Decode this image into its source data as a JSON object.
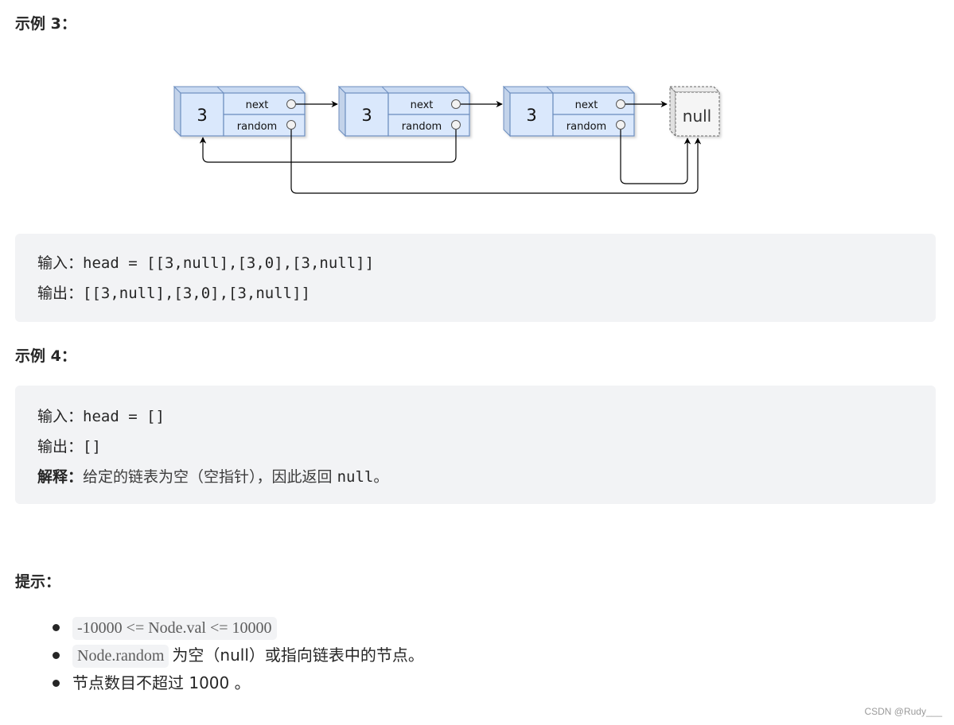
{
  "example3": {
    "heading": "示例 3：",
    "diagram": {
      "nodes": [
        {
          "value": "3",
          "next_label": "next",
          "random_label": "random"
        },
        {
          "value": "3",
          "next_label": "next",
          "random_label": "random"
        },
        {
          "value": "3",
          "next_label": "next",
          "random_label": "random"
        }
      ],
      "null_label": "null",
      "colors": {
        "node_fill": "#dae8fc",
        "node_stroke": "#6c8ebf",
        "null_fill": "#f5f5f5",
        "null_stroke": "#666666"
      }
    },
    "input_label": "输入：",
    "input_value": "head = [[3,null],[3,0],[3,null]]",
    "output_label": "输出：",
    "output_value": "[[3,null],[3,0],[3,null]]"
  },
  "example4": {
    "heading": "示例 4：",
    "input_label": "输入：",
    "input_value": "head = []",
    "output_label": "输出：",
    "output_value": "[]",
    "explain_label": "解释：",
    "explain_text": "给定的链表为空（空指针），因此返回 ",
    "explain_code": "null",
    "explain_end": "。"
  },
  "hints": {
    "heading": "提示：",
    "items": [
      {
        "code": "-10000 <= Node.val <= 10000",
        "text": ""
      },
      {
        "code": "Node.random",
        "text": "为空（null）或指向链表中的节点。"
      },
      {
        "code": "",
        "text": "节点数目不超过 1000 。"
      }
    ]
  },
  "watermark": "CSDN @Rudy___",
  "colors": {
    "code_bg": "#f2f3f5",
    "text": "#262626"
  }
}
